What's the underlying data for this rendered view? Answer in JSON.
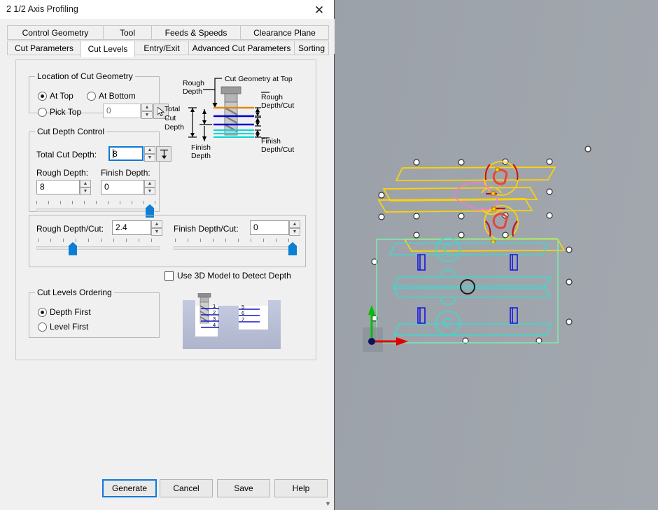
{
  "window": {
    "title": "2 1/2 Axis Profiling",
    "close_icon": "close-icon"
  },
  "tabs": {
    "row1": [
      {
        "label": "Control Geometry",
        "active": false
      },
      {
        "label": "Tool",
        "active": false
      },
      {
        "label": "Feeds & Speeds",
        "active": false
      },
      {
        "label": "Clearance Plane",
        "active": false
      }
    ],
    "row2": [
      {
        "label": "Cut Parameters",
        "active": false
      },
      {
        "label": "Cut Levels",
        "active": true
      },
      {
        "label": "Entry/Exit",
        "active": false
      },
      {
        "label": "Advanced Cut Parameters",
        "active": false
      },
      {
        "label": "Sorting",
        "active": false
      }
    ]
  },
  "location_group": {
    "legend": "Location of Cut Geometry",
    "at_top": "At Top",
    "at_bottom": "At Bottom",
    "pick_top": "Pick Top",
    "pick_top_value": "0",
    "selected": "At Top",
    "pick_icon": "cursor-pick-icon"
  },
  "cut_depth_group": {
    "legend": "Cut Depth Control",
    "total_cut_depth_label": "Total Cut Depth:",
    "total_cut_depth_value": "8",
    "rough_depth_label": "Rough Depth:",
    "rough_depth_value": "8",
    "finish_depth_label": "Finish Depth:",
    "finish_depth_value": "0",
    "depth_icon": "total-depth-icon"
  },
  "depth_per_cut": {
    "rough_label": "Rough Depth/Cut:",
    "rough_value": "2.4",
    "finish_label": "Finish Depth/Cut:",
    "finish_value": "0"
  },
  "detect_depth": {
    "label": "Use 3D Model to Detect Depth",
    "checked": false
  },
  "ordering_group": {
    "legend": "Cut Levels Ordering",
    "depth_first": "Depth First",
    "level_first": "Level First",
    "selected": "Depth First",
    "diagram_levels_left": [
      "1",
      "2",
      "3",
      "4"
    ],
    "diagram_levels_right": [
      "5",
      "6",
      "7"
    ]
  },
  "depth_diagram": {
    "cut_geometry_at_top": "Cut Geometry at Top",
    "rough_depth": "Rough\nDepth",
    "rough_depth_l1": "Rough",
    "rough_depth_l2": "Depth",
    "total_cut_depth_l1": "Total",
    "total_cut_depth_l2": "Cut",
    "total_cut_depth_l3": "Depth",
    "finish_depth_l1": "Finish",
    "finish_depth_l2": "Depth",
    "rough_depth_cut_l1": "Rough",
    "rough_depth_cut_l2": "Depth/Cut",
    "finish_depth_cut_l1": "Finish",
    "finish_depth_cut_l2": "Depth/Cut"
  },
  "footer": {
    "generate": "Generate",
    "cancel": "Cancel",
    "save": "Save",
    "help": "Help",
    "scroll_icon": "chevron-down-icon"
  },
  "colors": {
    "accent": "#0d7ad9",
    "toolpath_yellow": "#ffd400",
    "geometry_cyan": "#3fd8cc",
    "boundary_green": "#7fe8b0",
    "feature_blue": "#1515e0",
    "rapid_magenta": "#ff72e0",
    "arc_red": "#c01020",
    "axis_red": "#e00000",
    "axis_green": "#00c000",
    "viewport_bg": "#9aa0a8"
  }
}
